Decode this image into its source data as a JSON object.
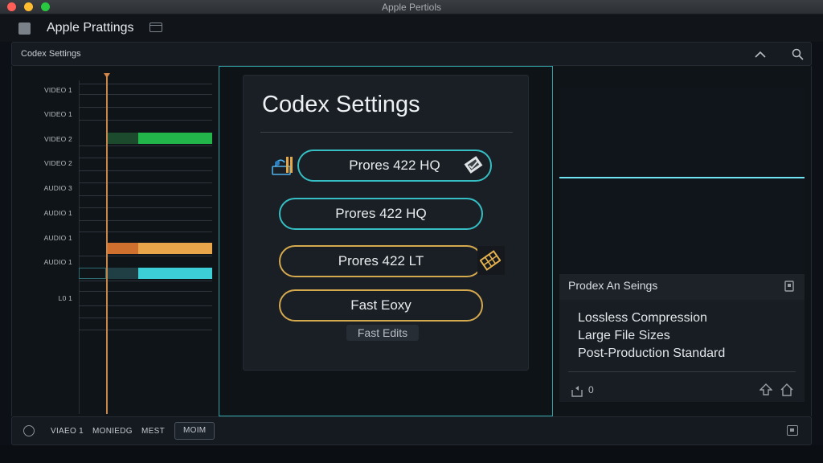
{
  "window": {
    "title": "Apple Pertiols"
  },
  "app": {
    "title": "Apple Prattings"
  },
  "panel": {
    "title": "Codex Settings"
  },
  "timeline": {
    "tracks": [
      "VIDEO 1",
      "VIDEO 1",
      "VIDEO 2",
      "VIDEO 2",
      "AUDIO 3",
      "AUDIO 1",
      "AUDIO 1",
      "AUDIO 1",
      "L0 1"
    ],
    "clip_colors": {
      "green": "#22b54a",
      "orange": "#e8a54a",
      "cyan": "#3ccfd8"
    }
  },
  "codex": {
    "title": "Codex Settings",
    "options": [
      {
        "label": "Prores 422 HQ",
        "style": "teal",
        "icon": "film-edit-icon",
        "right_icon": "clipboard-check-icon"
      },
      {
        "label": "Prores 422 HQ",
        "style": "teal"
      },
      {
        "label": "Prores 422 LT",
        "style": "gold",
        "right_icon": "lightning-grid-icon"
      },
      {
        "label": "Fast Eoxy",
        "style": "gold"
      }
    ],
    "sublabel": "Fast Edits"
  },
  "details": {
    "title": "Prodex An Seings",
    "features": [
      "Lossless Compression",
      "Large File Sizes",
      "Post-Production Standard"
    ],
    "count": "0"
  },
  "bottom": {
    "tabs": [
      "VIAEO 1",
      "MONIEDG",
      "MEST",
      "MOIM"
    ],
    "active_tab": "MOIM"
  },
  "colors": {
    "accent_teal": "#35bfc4",
    "accent_gold": "#d5a94e",
    "playhead": "#c7874a"
  }
}
